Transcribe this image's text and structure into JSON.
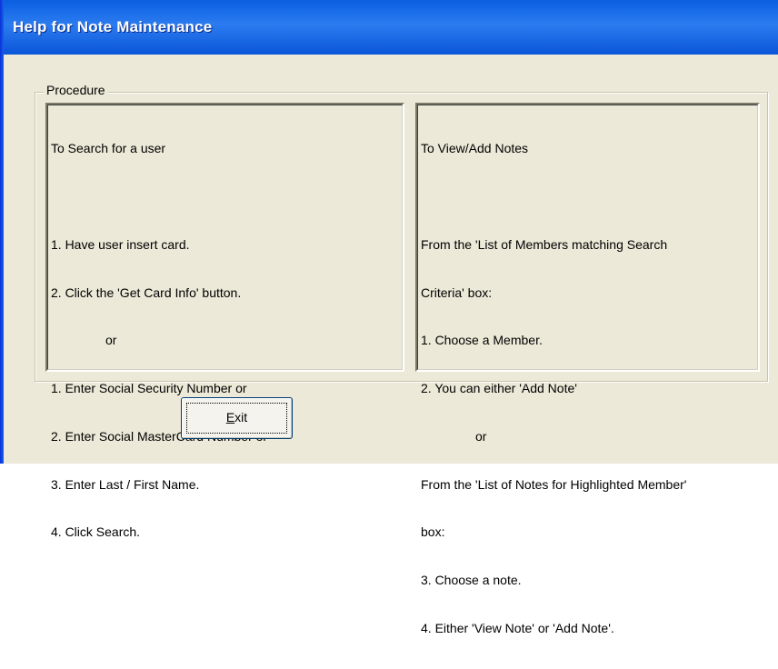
{
  "window": {
    "title": "Help for Note Maintenance"
  },
  "procedure": {
    "group_label": "Procedure",
    "search_panel": {
      "lines": [
        "To Search for a user",
        "",
        "1. Have user insert card.",
        "2. Click the 'Get Card Info' button.",
        "or",
        "1. Enter Social Security Number or",
        "2. Enter Social MasterCard Number or",
        "3. Enter Last / First Name.",
        "4. Click Search."
      ]
    },
    "notes_panel": {
      "lines": [
        "To View/Add Notes",
        "",
        "From the 'List of Members matching Search",
        "Criteria' box:",
        "1. Choose a Member.",
        "2. You can either 'Add Note'",
        "or",
        "From the 'List of Notes for Highlighted Member'",
        "box:",
        "3. Choose a note.",
        "4. Either 'View Note' or 'Add Note'."
      ]
    }
  },
  "buttons": {
    "exit_label_accel": "E",
    "exit_label_rest": "xit"
  }
}
